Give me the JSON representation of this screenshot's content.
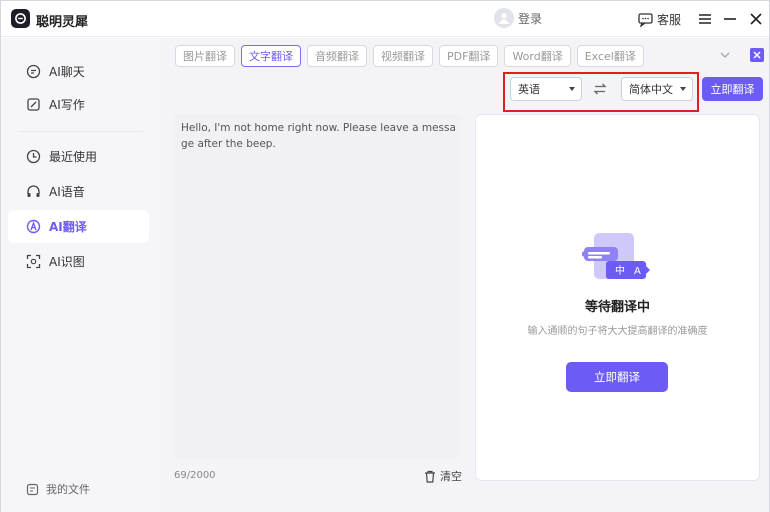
{
  "app": {
    "title": "聪明灵犀"
  },
  "titlebar": {
    "login_label": "登录",
    "service_label": "客服"
  },
  "sidebar": {
    "items": [
      {
        "label": "AI聊天",
        "icon": "chat-icon"
      },
      {
        "label": "AI写作",
        "icon": "write-icon"
      },
      {
        "label": "最近使用",
        "icon": "clock-icon"
      },
      {
        "label": "AI语音",
        "icon": "headphones-icon"
      },
      {
        "label": "AI翻译",
        "icon": "translate-icon",
        "active": true
      },
      {
        "label": "AI识图",
        "icon": "scan-icon"
      }
    ],
    "my_files": "我的文件"
  },
  "tabs": [
    {
      "label": "图片翻译"
    },
    {
      "label": "文字翻译",
      "active": true
    },
    {
      "label": "音频翻译"
    },
    {
      "label": "视频翻译"
    },
    {
      "label": "PDF翻译"
    },
    {
      "label": "Word翻译"
    },
    {
      "label": "Excel翻译"
    }
  ],
  "translator": {
    "source_lang": "英语",
    "target_lang": "简体中文",
    "translate_label": "立即翻译",
    "source_text": "Hello, I'm not home right now. Please leave a message after the beep.",
    "char_count": "69/2000",
    "clear_label": "清空"
  },
  "result": {
    "illus_zh": "中",
    "illus_a": "A",
    "title": "等待翻译中",
    "subtitle": "输入通顺的句子将大大提高翻译的准确度",
    "button_label": "立即翻译"
  },
  "colors": {
    "accent": "#6c5cf5",
    "highlight_box": "#e0201e",
    "sidebar_bg": "#f6f6f9",
    "main_bg": "#f4f4f8"
  }
}
